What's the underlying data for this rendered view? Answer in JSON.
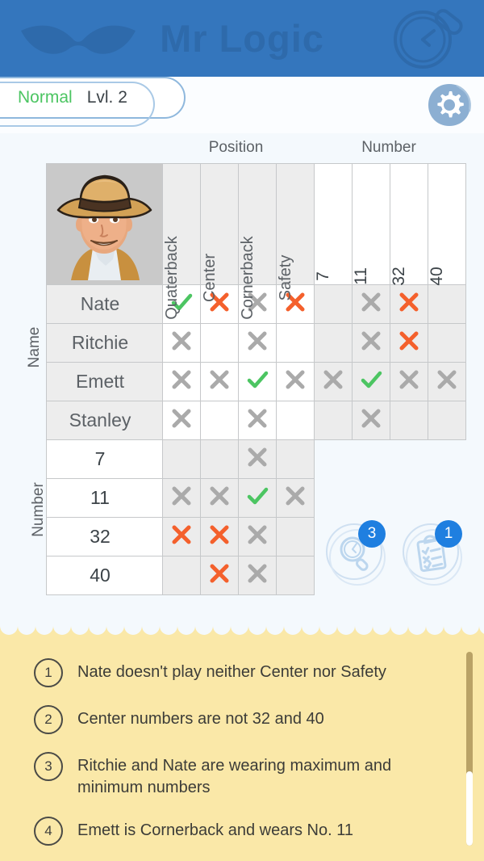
{
  "app": {
    "title": "Mr Logic",
    "banner_color": "#3476bd",
    "accent_color": "#1f7fe0",
    "logo_icon": "moustache-icon",
    "deco_icon": "magnifier-icon"
  },
  "status": {
    "difficulty": "Normal",
    "difficulty_color": "#4cc562",
    "level": "Lvl. 2",
    "settings_icon": "gear-icon"
  },
  "grid": {
    "avatar_icon": "detective-avatar",
    "col_group_labels": [
      "Position",
      "Number"
    ],
    "row_group_labels": [
      "Name",
      "Number"
    ],
    "position_columns": [
      "Quaterback",
      "Center",
      "Cornerback",
      "Safety"
    ],
    "number_columns": [
      "7",
      "11",
      "32",
      "40"
    ],
    "name_rows": [
      "Nate",
      "Ritchie",
      "Emett",
      "Stanley"
    ],
    "number_rows": [
      "7",
      "11",
      "32",
      "40"
    ],
    "mark_colors": {
      "check": "#4cc562",
      "cross_red": "#f4602c",
      "cross_gray": "#aaaaaa"
    },
    "names_vs_positions": [
      [
        "check",
        "cross-red",
        "cross-gray",
        "cross-red"
      ],
      [
        "cross-gray",
        "",
        "cross-gray",
        ""
      ],
      [
        "cross-gray",
        "cross-gray",
        "check",
        "cross-gray"
      ],
      [
        "cross-gray",
        "",
        "cross-gray",
        ""
      ]
    ],
    "names_vs_numbers": [
      [
        "",
        "cross-gray",
        "cross-red",
        ""
      ],
      [
        "",
        "cross-gray",
        "cross-red",
        ""
      ],
      [
        "cross-gray",
        "check",
        "cross-gray",
        "cross-gray"
      ],
      [
        "",
        "cross-gray",
        "",
        ""
      ]
    ],
    "numbers_vs_positions": [
      [
        "",
        "",
        "cross-gray",
        ""
      ],
      [
        "cross-gray",
        "cross-gray",
        "check",
        "cross-gray"
      ],
      [
        "cross-red",
        "cross-red",
        "cross-gray",
        ""
      ],
      [
        "",
        "cross-red",
        "cross-gray",
        ""
      ]
    ]
  },
  "actions": {
    "hint": {
      "icon": "magnifier-icon",
      "badge": "3"
    },
    "notes": {
      "icon": "clipboard-icon",
      "badge": "1"
    }
  },
  "clues": [
    {
      "number": "1",
      "text": "Nate doesn't play neither Center nor Safety"
    },
    {
      "number": "2",
      "text": "Center numbers are not 32 and 40"
    },
    {
      "number": "3",
      "text": "Ritchie and Nate are wearing maximum and minimum numbers"
    },
    {
      "number": "4",
      "text": "Emett is Cornerback and wears No. 11"
    }
  ]
}
